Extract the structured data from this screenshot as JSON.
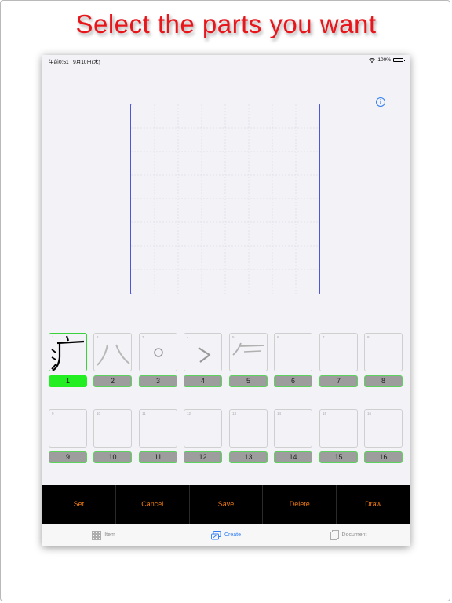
{
  "headline": "Select the parts you want",
  "status": {
    "time": "午前0:51",
    "date": "9月10日(木)",
    "battery": "100%",
    "wifi_icon": "wifi-icon",
    "battery_icon": "battery-icon"
  },
  "info_icon": "info-icon",
  "parts": [
    {
      "index": "1",
      "label": "1",
      "glyph": "广",
      "selected": true
    },
    {
      "index": "2",
      "label": "2",
      "glyph": "八",
      "selected": false
    },
    {
      "index": "3",
      "label": "3",
      "glyph": "○",
      "selected": false
    },
    {
      "index": "4",
      "label": "4",
      "glyph": "冫-stroke",
      "selected": false
    },
    {
      "index": "5",
      "label": "5",
      "glyph": "𠂉",
      "selected": false
    },
    {
      "index": "6",
      "label": "6",
      "glyph": "",
      "selected": false
    },
    {
      "index": "7",
      "label": "7",
      "glyph": "",
      "selected": false
    },
    {
      "index": "8",
      "label": "8",
      "glyph": "",
      "selected": false
    },
    {
      "index": "9",
      "label": "9",
      "glyph": "",
      "selected": false
    },
    {
      "index": "10",
      "label": "10",
      "glyph": "",
      "selected": false
    },
    {
      "index": "11",
      "label": "11",
      "glyph": "",
      "selected": false
    },
    {
      "index": "12",
      "label": "12",
      "glyph": "",
      "selected": false
    },
    {
      "index": "13",
      "label": "13",
      "glyph": "",
      "selected": false
    },
    {
      "index": "14",
      "label": "14",
      "glyph": "",
      "selected": false
    },
    {
      "index": "15",
      "label": "15",
      "glyph": "",
      "selected": false
    },
    {
      "index": "16",
      "label": "16",
      "glyph": "",
      "selected": false
    }
  ],
  "toolbar": {
    "set": "Set",
    "cancel": "Cancel",
    "save": "Save",
    "delete": "Delete",
    "draw": "Draw"
  },
  "tabs": [
    {
      "label": "Item",
      "icon": "grid-icon",
      "active": false
    },
    {
      "label": "Create",
      "icon": "create-icon",
      "active": true
    },
    {
      "label": "Document",
      "icon": "document-icon",
      "active": false
    }
  ],
  "colors": {
    "headline": "#e8151b",
    "selected_tag": "#22ee22",
    "toolbar_text": "#f07a10",
    "accent_blue": "#2d7cf6",
    "canvas_border": "#4f55d8"
  }
}
